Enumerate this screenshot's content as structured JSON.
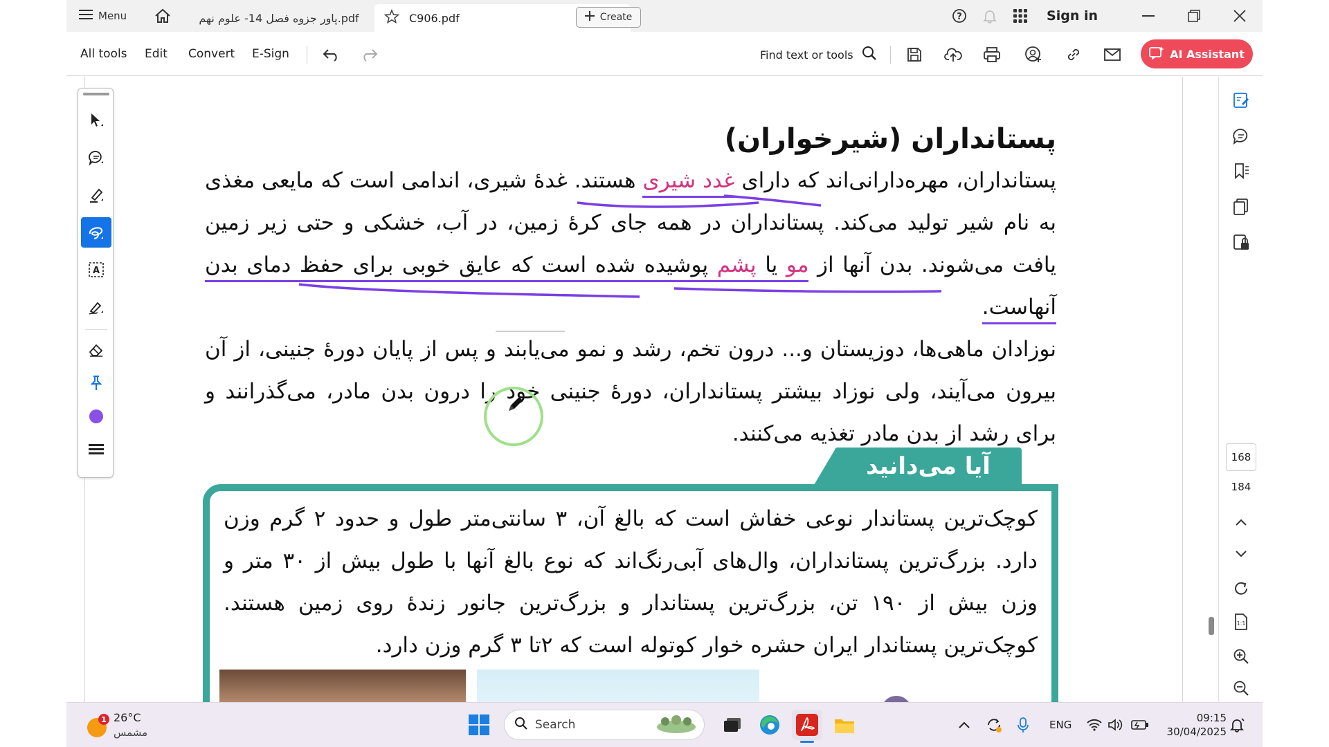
{
  "tabbar": {
    "menu_label": "Menu",
    "tabs": [
      {
        "label": "پاور جزوه فصل 14- علوم نهم.pdf",
        "active": false
      },
      {
        "label": "C906.pdf",
        "active": true
      }
    ],
    "create_label": "Create",
    "sign_in_label": "Sign in"
  },
  "toolbar": {
    "menus": [
      "All tools",
      "Edit",
      "Convert",
      "E-Sign"
    ],
    "find_label": "Find text or tools",
    "ai_label": "AI Assistant",
    "accent": "#ee4a5a"
  },
  "document": {
    "heading": "پستانداران (شیرخواران)",
    "p1": {
      "a": "پستانداران، مهره‌دارانی‌اند که دارای ",
      "b": "غدد شیری",
      "c": " هستند. غدهٔ شیری، اندامی است که مایعی مغذی به نام شیر تولید می‌کند. پستانداران در همه جای کرهٔ زمین، در آب، خشکی و حتی زیر زمین یافت می‌شوند. بدن آنها از ",
      "d": "مو",
      "e": " یا ",
      "f": "پشم",
      "g": " پوشیده شده است که عایق خوبی برای حفظ دمای بدن آنهاست."
    },
    "p2": "نوزادان ماهی‌ها، دوزیستان و... درون تخم، رشد و نمو می‌یابند و پس از پایان دورهٔ جنینی، از آن بیرون می‌آیند، ولی نوزاد بیشتر پستانداران، دورهٔ جنینی خود را درون بدن مادر، می‌گذرانند و برای رشد از بدن مادر تغذیه می‌کنند.",
    "box_title": "آیا می‌دانید",
    "box_text": "کوچک‌ترین پستاندار نوعی خفاش است که بالغ آن، ۳ سانتی‌متر طول و حدود ۲ گرم وزن دارد. بزرگ‌ترین پستانداران، وال‌های آبی‌رنگ‌اند که نوع بالغ آنها با طول بیش از ۳۰ متر و وزن بیش از ۱۹۰ تن، بزرگ‌ترین پستاندار و بزرگ‌ترین جانور زندهٔ روی زمین هستند. کوچک‌ترین پستاندار ایران حشره خوار کوتوله است که ۲تا ۳ گرم وزن دارد.",
    "highlight_color": "#d5317f",
    "box_color": "#3aa79a",
    "ink_color": "#7b3fe4"
  },
  "sidebar": {
    "current_page": "168",
    "total_pages": "184"
  },
  "taskbar": {
    "temp": "26°C",
    "condition": "مشمس",
    "weather_badge": "1",
    "search_label": "Search",
    "lang": "ENG",
    "time": "09:15",
    "date": "30/04/2025"
  }
}
